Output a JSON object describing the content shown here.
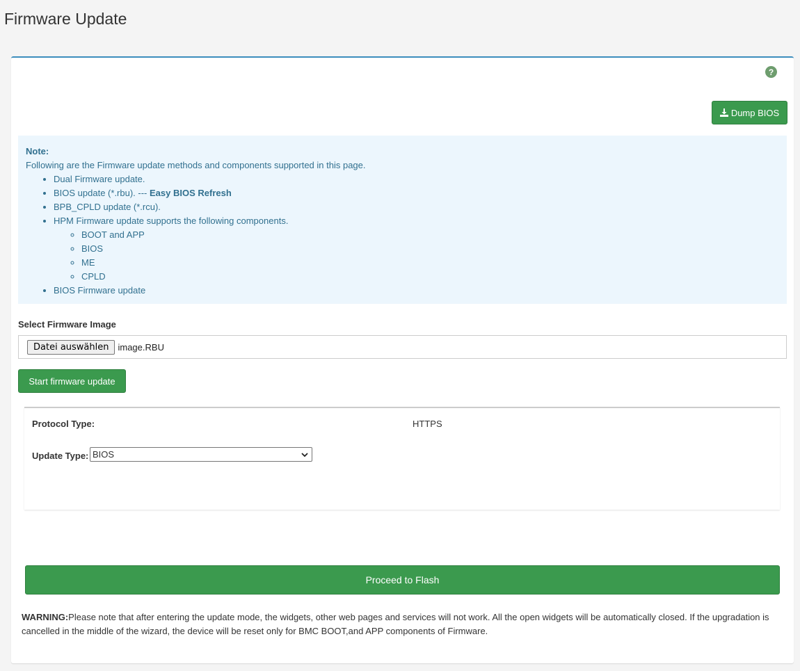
{
  "page": {
    "title": "Firmware Update"
  },
  "toolbar": {
    "help_icon": "question-circle-icon",
    "dump_label": "Dump BIOS",
    "dump_icon": "download-icon"
  },
  "note": {
    "title": "Note:",
    "intro": "Following are the Firmware update methods and components supported in this page.",
    "items": [
      {
        "text": "Dual Firmware update."
      },
      {
        "text": "BIOS update (*.rbu). --- ",
        "bold": "Easy BIOS Refresh"
      },
      {
        "text": "BPB_CPLD update (*.rcu)."
      },
      {
        "text": "HPM Firmware update supports the following components.",
        "sub": [
          "BOOT and APP",
          "BIOS",
          "ME",
          "CPLD"
        ]
      },
      {
        "text": "BIOS Firmware update"
      }
    ]
  },
  "firmware": {
    "select_label": "Select Firmware Image",
    "choose_button": "Datei auswählen",
    "file_name": "image.RBU",
    "start_button": "Start firmware update"
  },
  "protocol": {
    "label": "Protocol Type:",
    "value": "HTTPS",
    "update_label": "Update Type:",
    "update_value": "BIOS"
  },
  "proceed_button": "Proceed to Flash",
  "warning": {
    "prefix": "WARNING:",
    "text": "Please note that after entering the update mode, the widgets, other web pages and services will not work. All the open widgets will be automatically closed. If the upgradation is cancelled in the middle of the wizard, the device will be reset only for BMC BOOT,and APP components of Firmware."
  }
}
